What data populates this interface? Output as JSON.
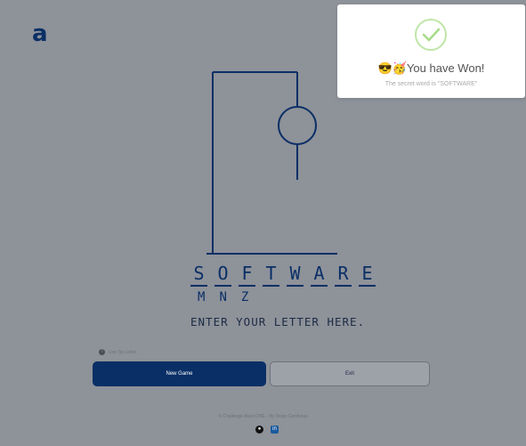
{
  "header": {
    "logo_text": "a"
  },
  "game": {
    "word_letters": [
      "S",
      "O",
      "F",
      "T",
      "W",
      "A",
      "R",
      "E"
    ],
    "wrong_letters": [
      "M",
      "N",
      "Z"
    ],
    "input_prompt": "ENTER YOUR LETTER HERE.",
    "tip_text": "Use Tip Letter"
  },
  "buttons": {
    "new_game": "New Game",
    "exit": "Exit"
  },
  "footer": {
    "credit": "© Challenge Alura ONE - By Diego Cardenas",
    "icons": [
      "github-icon",
      "linkedin-icon"
    ]
  },
  "modal": {
    "emojis": "😎🥳",
    "title": "You have Won!",
    "subtitle": "The secret word is \"SOFTWARE\""
  },
  "colors": {
    "background": "#8e9299",
    "primary": "#0a2f66",
    "success_check": "#a5dc86"
  }
}
